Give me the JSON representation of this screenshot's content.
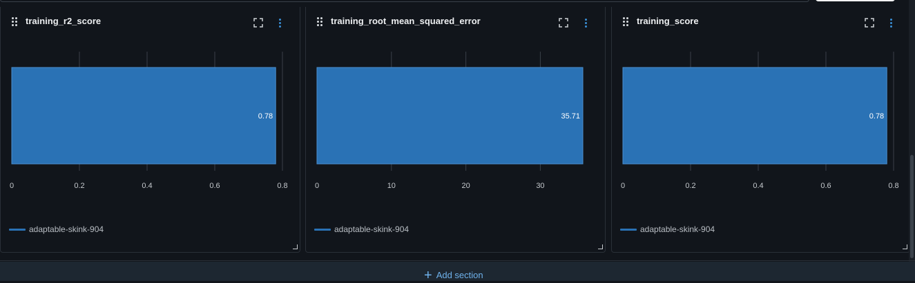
{
  "colors": {
    "bar": "#2a72b5",
    "accent": "#3a8fd6",
    "grid": "#3a4048",
    "background": "#11151b"
  },
  "panels": [
    {
      "title": "training_r2_score",
      "legend": "adaptable-skink-904",
      "chart_data": {
        "type": "bar",
        "orientation": "horizontal",
        "categories": [
          "adaptable-skink-904"
        ],
        "values": [
          0.78
        ],
        "value_labels": [
          "0.78"
        ],
        "xlim": [
          0,
          0.8
        ],
        "xticks": [
          "0",
          "0.2",
          "0.4",
          "0.6",
          "0.8"
        ],
        "xtick_values": [
          0,
          0.2,
          0.4,
          0.6,
          0.8
        ],
        "grid": true
      }
    },
    {
      "title": "training_root_mean_squared_error",
      "legend": "adaptable-skink-904",
      "chart_data": {
        "type": "bar",
        "orientation": "horizontal",
        "categories": [
          "adaptable-skink-904"
        ],
        "values": [
          35.71
        ],
        "value_labels": [
          "35.71"
        ],
        "xlim": [
          0,
          35.71
        ],
        "xticks": [
          "0",
          "10",
          "20",
          "30"
        ],
        "xtick_values": [
          0,
          10,
          20,
          30
        ],
        "grid": true
      }
    },
    {
      "title": "training_score",
      "legend": "adaptable-skink-904",
      "chart_data": {
        "type": "bar",
        "orientation": "horizontal",
        "categories": [
          "adaptable-skink-904"
        ],
        "values": [
          0.78
        ],
        "value_labels": [
          "0.78"
        ],
        "xlim": [
          0,
          0.8
        ],
        "xticks": [
          "0",
          "0.2",
          "0.4",
          "0.6",
          "0.8"
        ],
        "xtick_values": [
          0,
          0.2,
          0.4,
          0.6,
          0.8
        ],
        "grid": true
      }
    }
  ],
  "add_section": {
    "label": "Add section",
    "icon": "plus-icon"
  }
}
